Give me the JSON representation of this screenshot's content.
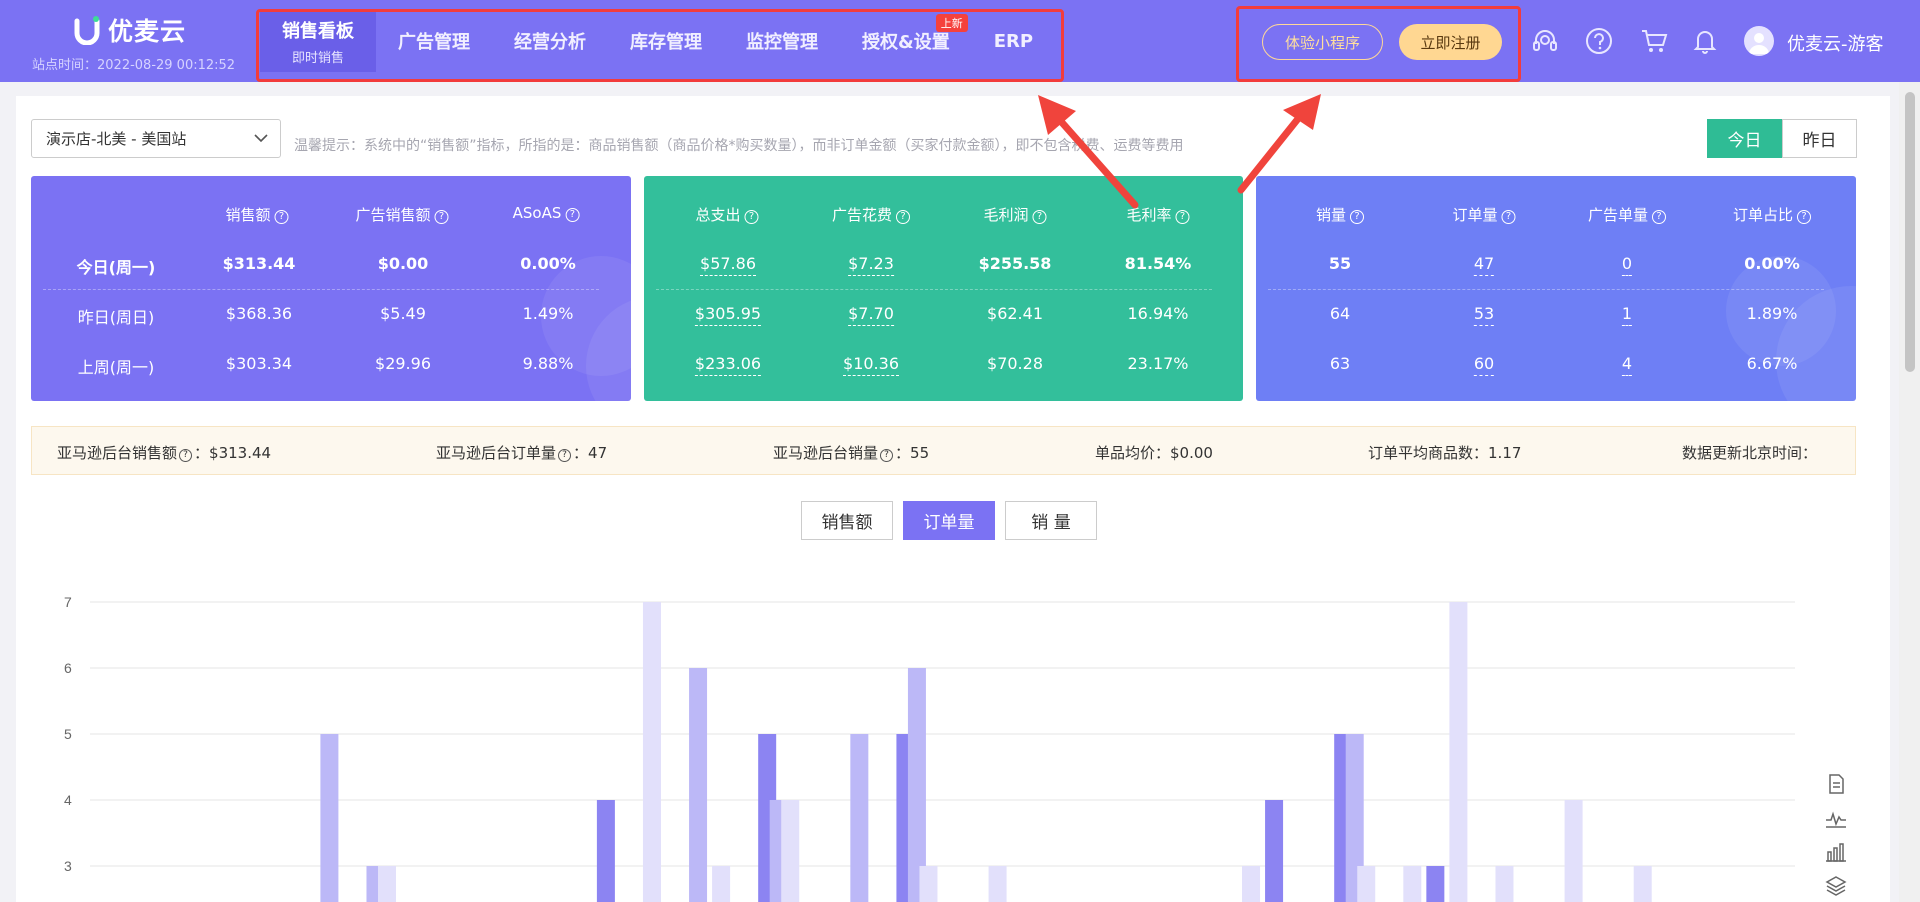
{
  "header": {
    "logo_text": "优麦云",
    "site_time": "站点时间：2022-08-29 00:12:52",
    "nav": [
      {
        "label": "销售看板",
        "sub": "即时销售",
        "active": true
      },
      {
        "label": "广告管理"
      },
      {
        "label": "经营分析"
      },
      {
        "label": "库存管理"
      },
      {
        "label": "监控管理"
      },
      {
        "label": "授权&设置",
        "badge": "上新"
      },
      {
        "label": "ERP"
      }
    ],
    "mini_program_button": "体验小程序",
    "register_button": "立即注册",
    "user_name": "优麦云-游客",
    "icons": [
      "headset-icon",
      "help-icon",
      "cart-icon",
      "bell-icon",
      "avatar-icon"
    ]
  },
  "toolbar": {
    "store": "演示店-北美 - 美国站",
    "tip": "温馨提示：系统中的“销售额”指标，所指的是：商品销售额（商品价格*购买数量），而非订单金额（买家付款金额），即不包含税费、运费等费用",
    "today": "今日",
    "yesterday": "昨日"
  },
  "panels": [
    {
      "color": "#7b72f3",
      "headers": [
        "销售额",
        "广告销售额",
        "ASoAS"
      ],
      "rows": [
        {
          "label": "今日(周一)",
          "values": [
            "$313.44",
            "$0.00",
            "0.00%"
          ]
        },
        {
          "label": "昨日(周日)",
          "values": [
            "$368.36",
            "$5.49",
            "1.49%"
          ]
        },
        {
          "label": "上周(周一)",
          "values": [
            "$303.34",
            "$29.96",
            "9.88%"
          ]
        }
      ]
    },
    {
      "color": "#33bf9b",
      "headers": [
        "总支出",
        "广告花费",
        "毛利润",
        "毛利率"
      ],
      "rows": [
        {
          "values": [
            "$57.86",
            "$7.23",
            "$255.58",
            "81.54%"
          ]
        },
        {
          "values": [
            "$305.95",
            "$7.70",
            "$62.41",
            "16.94%"
          ]
        },
        {
          "values": [
            "$233.06",
            "$10.36",
            "$70.28",
            "23.17%"
          ]
        }
      ]
    },
    {
      "color": "#6e7ff5",
      "headers": [
        "销量",
        "订单量",
        "广告单量",
        "订单占比"
      ],
      "rows": [
        {
          "values": [
            "55",
            "47",
            "0",
            "0.00%"
          ]
        },
        {
          "values": [
            "64",
            "53",
            "1",
            "1.89%"
          ]
        },
        {
          "values": [
            "63",
            "60",
            "4",
            "6.67%"
          ]
        }
      ]
    }
  ],
  "summary": {
    "amazon_sales_label": "亚马逊后台销售额",
    "amazon_sales": "$313.44",
    "amazon_orders_label": "亚马逊后台订单量",
    "amazon_orders": "47",
    "amazon_units_label": "亚马逊后台销量",
    "amazon_units": "55",
    "avg_price_label": "单品均价：",
    "avg_price": "$0.00",
    "avg_items_label": "订单平均商品数：",
    "avg_items": "1.17",
    "update_label": "数据更新北京时间："
  },
  "metric_tabs": [
    "销售额",
    "订单量",
    "销 量"
  ],
  "active_metric": "订单量",
  "chart_data": {
    "type": "bar",
    "y_ticks": [
      3,
      4,
      5,
      6,
      7
    ],
    "ylim": [
      2.7,
      7
    ],
    "series": [
      {
        "color": "#8c84f2",
        "values": [
          {
            "x": 22,
            "y": 4
          },
          {
            "x": 29,
            "y": 5
          },
          {
            "x": 35,
            "y": 5
          },
          {
            "x": 51,
            "y": 4
          },
          {
            "x": 54,
            "y": 5
          },
          {
            "x": 58,
            "y": 3
          }
        ]
      },
      {
        "color": "#bcb8f7",
        "values": [
          {
            "x": 10,
            "y": 5
          },
          {
            "x": 12,
            "y": 3
          },
          {
            "x": 26,
            "y": 6
          },
          {
            "x": 29.5,
            "y": 4
          },
          {
            "x": 33,
            "y": 5
          },
          {
            "x": 35.5,
            "y": 6
          },
          {
            "x": 54.5,
            "y": 5
          }
        ]
      },
      {
        "color": "#e2e0fb",
        "values": [
          {
            "x": 12.5,
            "y": 3
          },
          {
            "x": 24,
            "y": 7
          },
          {
            "x": 27,
            "y": 3
          },
          {
            "x": 30,
            "y": 4
          },
          {
            "x": 36,
            "y": 3
          },
          {
            "x": 39,
            "y": 3
          },
          {
            "x": 50,
            "y": 3
          },
          {
            "x": 55,
            "y": 3
          },
          {
            "x": 57,
            "y": 3
          },
          {
            "x": 59,
            "y": 7
          },
          {
            "x": 61,
            "y": 3
          },
          {
            "x": 64,
            "y": 4
          },
          {
            "x": 67,
            "y": 3
          }
        ]
      }
    ]
  }
}
